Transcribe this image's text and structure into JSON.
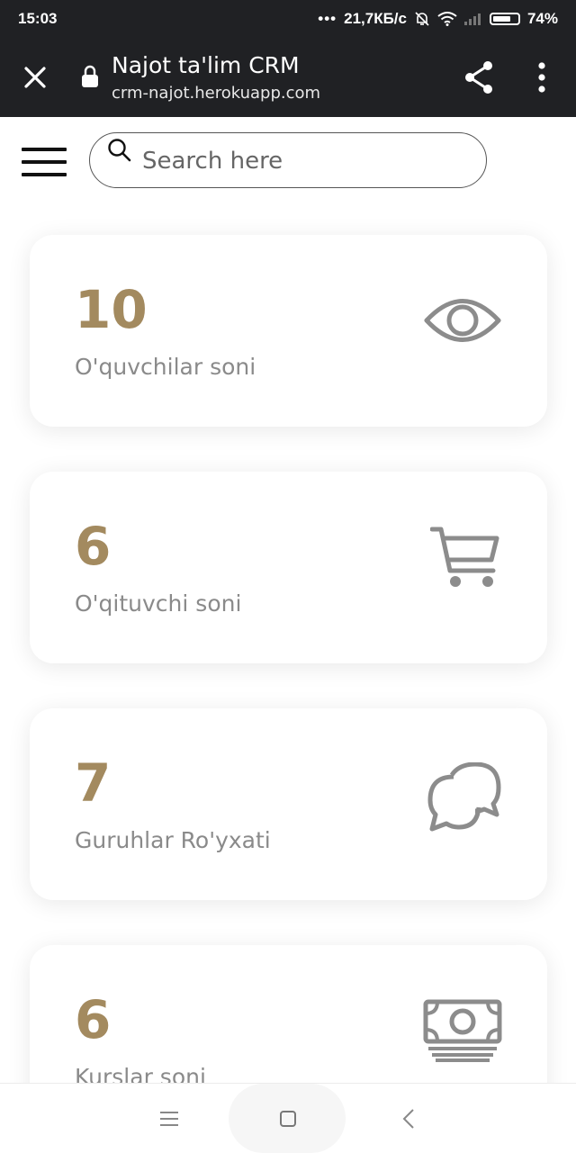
{
  "status_bar": {
    "time": "15:03",
    "net_speed": "21,7КБ/с",
    "battery": "74%",
    "battery_level": 0.74
  },
  "browser": {
    "title": "Najot ta'lim CRM",
    "url": "crm-najot.herokuapp.com"
  },
  "search": {
    "placeholder": "Search here",
    "value": ""
  },
  "cards": [
    {
      "count": "10",
      "label": "O'quvchilar soni",
      "icon": "eye-icon"
    },
    {
      "count": "6",
      "label": "O'qituvchi soni",
      "icon": "cart-icon"
    },
    {
      "count": "7",
      "label": "Guruhlar Ro'yxati",
      "icon": "chat-icon"
    },
    {
      "count": "6",
      "label": "Kurslar soni",
      "icon": "money-icon"
    }
  ],
  "colors": {
    "accent": "#a38a5f",
    "label": "#8a8a8a",
    "icon": "#8c8c8c",
    "chrome": "#202124"
  }
}
